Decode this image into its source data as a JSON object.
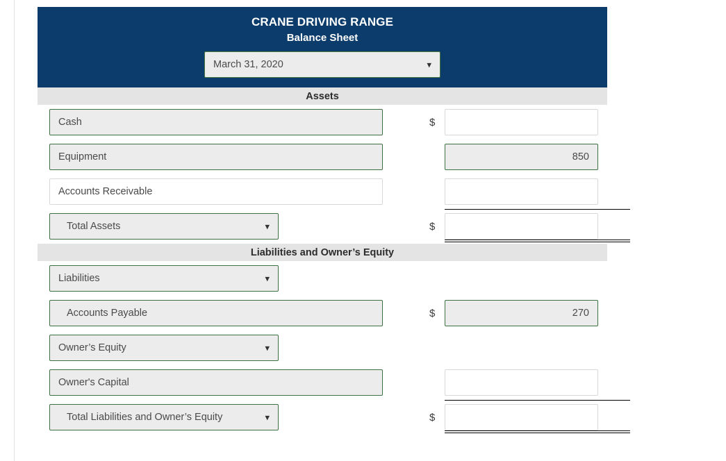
{
  "header": {
    "company_name": "CRANE DRIVING RANGE",
    "statement_name": "Balance Sheet",
    "date_value": "March 31, 2020",
    "chevron_icon": "chevron-down-icon",
    "bg_color": "#0b3c6b",
    "text_color": "#ffffff"
  },
  "sections": {
    "assets_band": "Assets",
    "liabilities_band": "Liabilities and Owner’s Equity",
    "band_color": "#e4e4e4"
  },
  "currency_symbol": "$",
  "rows": [
    {
      "label": "Cash",
      "amount": "",
      "dollar": "$",
      "label_style": "filled",
      "label_width": "wide",
      "amount_style": "blank",
      "is_dropdown": false,
      "indent": false
    },
    {
      "label": "Equipment",
      "amount": "850",
      "dollar": "",
      "label_style": "filled",
      "label_width": "wide",
      "amount_style": "filled",
      "is_dropdown": false,
      "indent": false
    },
    {
      "label": "Accounts Receivable",
      "amount": "",
      "dollar": "",
      "label_style": "blank",
      "label_width": "wide",
      "amount_style": "blank",
      "is_dropdown": false,
      "indent": false
    },
    {
      "label": "Total Assets",
      "amount": "",
      "dollar": "$",
      "label_style": "filled",
      "label_width": "narrow",
      "amount_style": "blank",
      "is_dropdown": true,
      "indent": true
    },
    {
      "label": "Liabilities",
      "amount": "",
      "dollar": "",
      "label_style": "filled",
      "label_width": "narrow",
      "amount_style": "none",
      "is_dropdown": true,
      "indent": false
    },
    {
      "label": "Accounts Payable",
      "amount": "270",
      "dollar": "$",
      "label_style": "filled",
      "label_width": "wide",
      "amount_style": "filled",
      "is_dropdown": false,
      "indent": true
    },
    {
      "label": "Owner’s Equity",
      "amount": "",
      "dollar": "",
      "label_style": "filled",
      "label_width": "narrow",
      "amount_style": "none",
      "is_dropdown": true,
      "indent": false
    },
    {
      "label": "Owner's Capital",
      "amount": "",
      "dollar": "",
      "label_style": "filled",
      "label_width": "wide",
      "amount_style": "blank",
      "is_dropdown": false,
      "indent": false
    },
    {
      "label": "Total Liabilities and Owner’s Equity",
      "amount": "",
      "dollar": "$",
      "label_style": "filled",
      "label_width": "narrow",
      "amount_style": "blank",
      "is_dropdown": true,
      "indent": true
    }
  ]
}
